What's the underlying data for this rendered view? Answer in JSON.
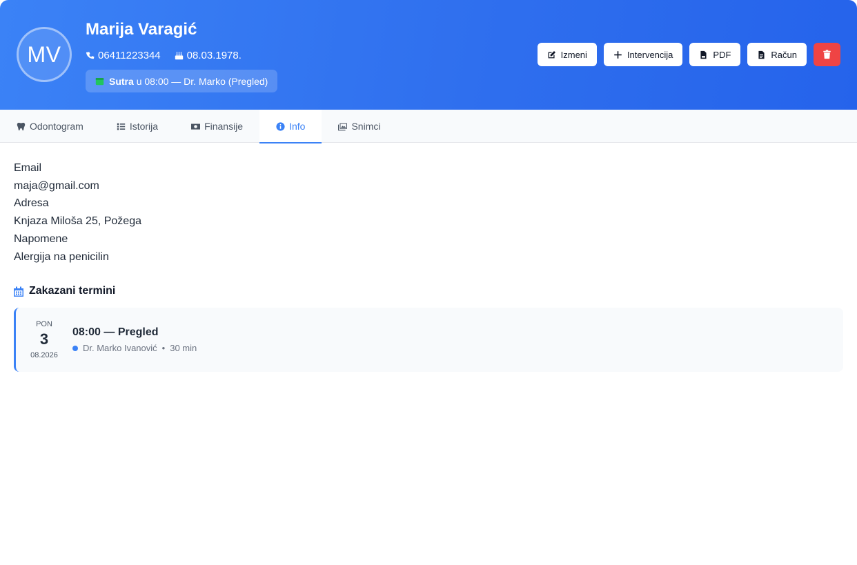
{
  "patient": {
    "initials": "MV",
    "name": "Marija Varagić",
    "phone": "06411223344",
    "birthdate": "08.03.1978.",
    "next_appointment": {
      "day_label": "Sutra",
      "rest": "u 08:00 — Dr. Marko (Pregled)"
    }
  },
  "actions": {
    "edit": "Izmeni",
    "intervention": "Intervencija",
    "pdf": "PDF",
    "invoice": "Račun"
  },
  "tabs": [
    {
      "label": "Odontogram",
      "icon": "tooth-icon"
    },
    {
      "label": "Istorija",
      "icon": "list-icon"
    },
    {
      "label": "Finansije",
      "icon": "money-icon"
    },
    {
      "label": "Info",
      "icon": "info-icon",
      "active": true
    },
    {
      "label": "Snimci",
      "icon": "images-icon"
    }
  ],
  "info": {
    "email_label": "Email",
    "email": "maja@gmail.com",
    "address_label": "Adresa",
    "address": "Knjaza Miloša 25, Požega",
    "notes_label": "Napomene",
    "notes": "Alergija na penicilin"
  },
  "scheduled": {
    "title": "Zakazani termini",
    "items": [
      {
        "dow": "PON",
        "day": "3",
        "month_year": "08.2026",
        "title": "08:00 — Pregled",
        "doctor": "Dr. Marko Ivanović",
        "duration": "30 min"
      }
    ]
  },
  "colors": {
    "header_start": "#3b82f6",
    "header_end": "#2563eb",
    "accent": "#3b82f6",
    "danger": "#ef4444",
    "calendar_green": "#22c55e"
  }
}
